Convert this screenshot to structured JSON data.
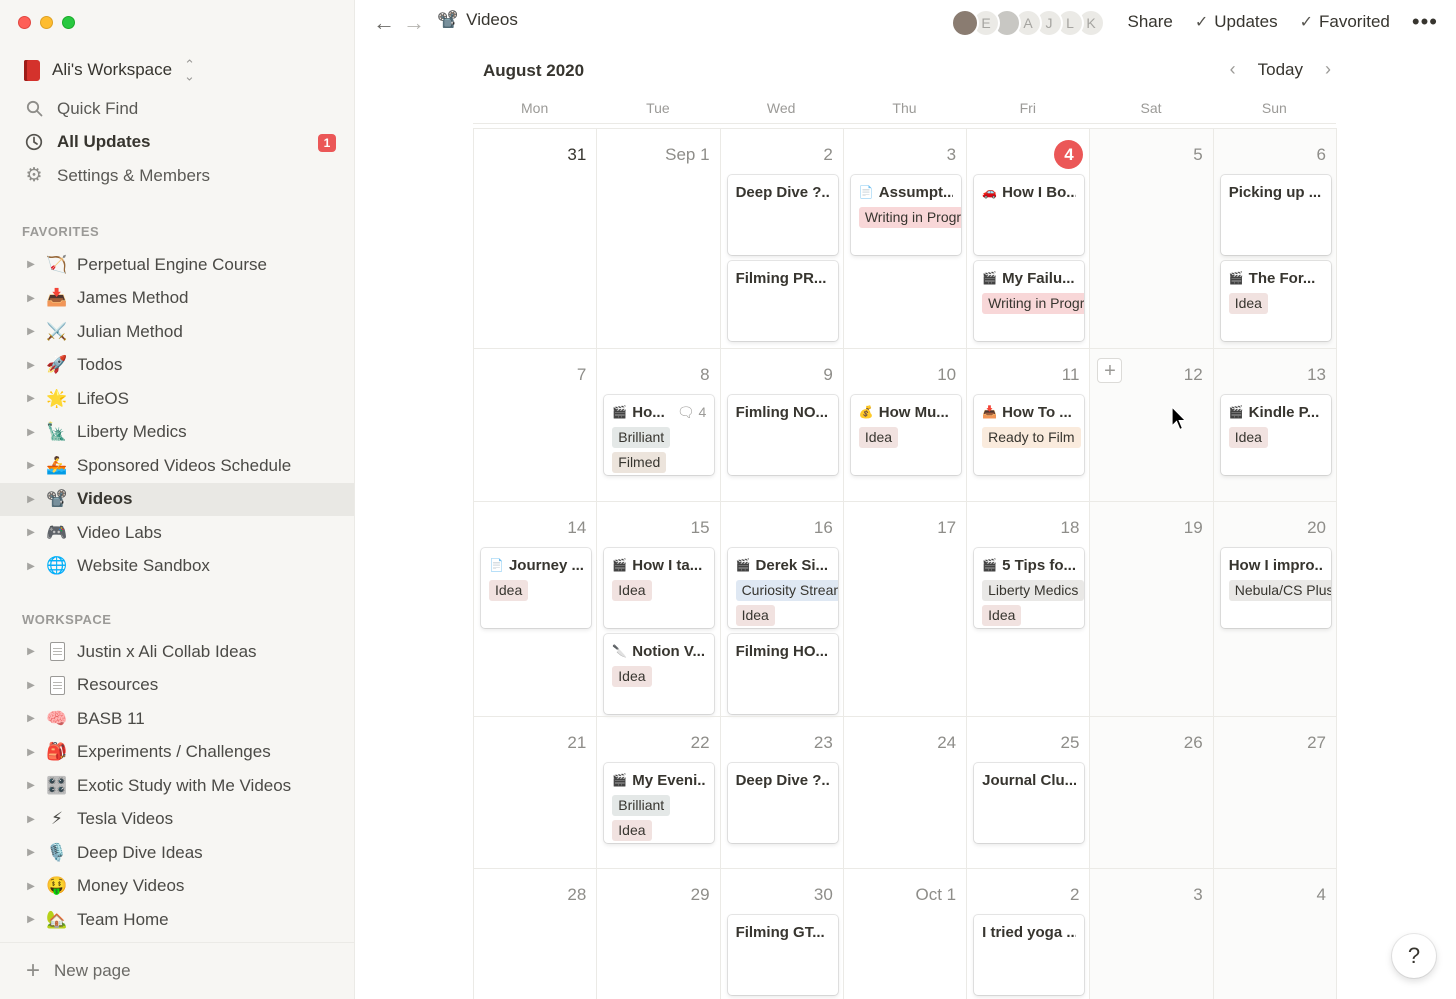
{
  "workspace": {
    "name": "Ali's Workspace"
  },
  "sidebar": {
    "top_items": [
      {
        "label": "Quick Find",
        "icon": "search-icon"
      },
      {
        "label": "All Updates",
        "icon": "clock-icon",
        "badge": "1"
      },
      {
        "label": "Settings & Members",
        "icon": "gear-icon"
      }
    ],
    "favorites_label": "FAVORITES",
    "favorites": [
      {
        "label": "Perpetual Engine Course",
        "emoji": "🏹"
      },
      {
        "label": "James Method",
        "emoji": "📥"
      },
      {
        "label": "Julian Method",
        "emoji": "⚔️"
      },
      {
        "label": "Todos",
        "emoji": "🚀"
      },
      {
        "label": "LifeOS",
        "emoji": "🌟"
      },
      {
        "label": "Liberty Medics",
        "emoji": "🗽"
      },
      {
        "label": "Sponsored Videos Schedule",
        "emoji": "🚣"
      },
      {
        "label": "Videos",
        "emoji": "📽️"
      },
      {
        "label": "Video Labs",
        "emoji": "🎮"
      },
      {
        "label": "Website Sandbox",
        "emoji": "🌐"
      }
    ],
    "workspace_label": "WORKSPACE",
    "workspace_pages": [
      {
        "label": "Justin x Ali Collab Ideas",
        "emoji": "doc"
      },
      {
        "label": "Resources",
        "emoji": "doc"
      },
      {
        "label": "BASB 11",
        "emoji": "🧠"
      },
      {
        "label": "Experiments / Challenges",
        "emoji": "🎒"
      },
      {
        "label": "Exotic Study with Me Videos",
        "emoji": "🎛️"
      },
      {
        "label": "Tesla Videos",
        "emoji": "⚡"
      },
      {
        "label": "Deep Dive Ideas",
        "emoji": "🎙️"
      },
      {
        "label": "Money Videos",
        "emoji": "🤑"
      },
      {
        "label": "Team Home",
        "emoji": "🏡"
      }
    ],
    "new_page": "New page"
  },
  "topbar": {
    "page_title": "Videos",
    "page_emoji": "📽️",
    "avatars": [
      "",
      "E",
      "",
      "A",
      "J",
      "L",
      "K"
    ],
    "share": "Share",
    "updates": "Updates",
    "favorited": "Favorited"
  },
  "calendar": {
    "month": "August 2020",
    "today": "Today",
    "weekdays": [
      "Mon",
      "Tue",
      "Wed",
      "Thu",
      "Fri",
      "Sat",
      "Sun"
    ],
    "weeks": [
      {
        "days": [
          {
            "num": "31",
            "dark": true,
            "cards": []
          },
          {
            "num": "Sep 1",
            "cards": []
          },
          {
            "num": "2",
            "cards": [
              {
                "title": "Deep Dive ?...",
                "icon": "",
                "tags": []
              },
              {
                "title": "Filming PR...",
                "icon": "",
                "tags": []
              }
            ]
          },
          {
            "num": "3",
            "cards": [
              {
                "title": "Assumpt...",
                "icon": "📄",
                "tags": [
                  {
                    "label": "Writing in Progress",
                    "kind": "writing"
                  }
                ]
              }
            ]
          },
          {
            "num": "4",
            "today": true,
            "cards": [
              {
                "title": "How I Bo...",
                "icon": "🚗",
                "tags": []
              },
              {
                "title": "My Failu...",
                "icon": "🎬",
                "tags": [
                  {
                    "label": "Writing in Progress",
                    "kind": "writing"
                  }
                ]
              }
            ]
          },
          {
            "num": "5",
            "weekend": true,
            "cards": []
          },
          {
            "num": "6",
            "weekend": true,
            "cards": [
              {
                "title": "Picking up ...",
                "icon": "",
                "tags": []
              },
              {
                "title": "The For...",
                "icon": "🎬",
                "tags": [
                  {
                    "label": "Idea",
                    "kind": "idea"
                  }
                ]
              }
            ]
          }
        ]
      },
      {
        "days": [
          {
            "num": "7",
            "cards": []
          },
          {
            "num": "8",
            "cards": [
              {
                "title": "Ho...",
                "icon": "🎬",
                "comments": "4",
                "tags": [
                  {
                    "label": "Brilliant",
                    "kind": "brilliant"
                  },
                  {
                    "label": "Filmed",
                    "kind": "filmed"
                  }
                ]
              }
            ]
          },
          {
            "num": "9",
            "cards": [
              {
                "title": "Fimling NO...",
                "icon": "",
                "tags": []
              }
            ]
          },
          {
            "num": "10",
            "cards": [
              {
                "title": "How Mu...",
                "icon": "💰",
                "tags": [
                  {
                    "label": "Idea",
                    "kind": "idea"
                  }
                ]
              }
            ]
          },
          {
            "num": "11",
            "cards": [
              {
                "title": "How To ...",
                "icon": "📥",
                "tags": [
                  {
                    "label": "Ready to Film",
                    "kind": "ready"
                  }
                ]
              }
            ]
          },
          {
            "num": "12",
            "weekend": true,
            "add": true,
            "cards": []
          },
          {
            "num": "13",
            "weekend": true,
            "cards": [
              {
                "title": "Kindle P...",
                "icon": "🎬",
                "tags": [
                  {
                    "label": "Idea",
                    "kind": "idea"
                  }
                ]
              }
            ]
          }
        ]
      },
      {
        "days": [
          {
            "num": "14",
            "cards": [
              {
                "title": "Journey ...",
                "icon": "📄",
                "tags": [
                  {
                    "label": "Idea",
                    "kind": "idea"
                  }
                ]
              }
            ]
          },
          {
            "num": "15",
            "cards": [
              {
                "title": "How I ta...",
                "icon": "🎬",
                "tags": [
                  {
                    "label": "Idea",
                    "kind": "idea"
                  }
                ]
              },
              {
                "title": "Notion V...",
                "icon": "🔪",
                "tags": [
                  {
                    "label": "Idea",
                    "kind": "idea"
                  }
                ]
              }
            ]
          },
          {
            "num": "16",
            "cards": [
              {
                "title": "Derek Si...",
                "icon": "🎬",
                "tags": [
                  {
                    "label": "Curiosity Stream",
                    "kind": "curiosity"
                  },
                  {
                    "label": "Idea",
                    "kind": "idea"
                  }
                ]
              },
              {
                "title": "Filming HO...",
                "icon": "",
                "tags": []
              }
            ]
          },
          {
            "num": "17",
            "cards": []
          },
          {
            "num": "18",
            "cards": [
              {
                "title": "5 Tips fo...",
                "icon": "🎬",
                "tags": [
                  {
                    "label": "Liberty Medics",
                    "kind": "liberty"
                  },
                  {
                    "label": "Idea",
                    "kind": "idea"
                  }
                ]
              }
            ]
          },
          {
            "num": "19",
            "weekend": true,
            "cards": []
          },
          {
            "num": "20",
            "weekend": true,
            "cards": [
              {
                "title": "How I impro...",
                "icon": "",
                "tags": [
                  {
                    "label": "Nebula/CS Plus",
                    "kind": "nebula"
                  }
                ]
              }
            ]
          }
        ]
      },
      {
        "days": [
          {
            "num": "21",
            "cards": []
          },
          {
            "num": "22",
            "cards": [
              {
                "title": "My Eveni...",
                "icon": "🎬",
                "tags": [
                  {
                    "label": "Brilliant",
                    "kind": "brilliant"
                  },
                  {
                    "label": "Idea",
                    "kind": "idea"
                  }
                ]
              }
            ]
          },
          {
            "num": "23",
            "cards": [
              {
                "title": "Deep Dive ?...",
                "icon": "",
                "tags": []
              }
            ]
          },
          {
            "num": "24",
            "cards": []
          },
          {
            "num": "25",
            "cards": [
              {
                "title": "Journal Clu...",
                "icon": "",
                "tags": []
              }
            ]
          },
          {
            "num": "26",
            "weekend": true,
            "cards": []
          },
          {
            "num": "27",
            "weekend": true,
            "cards": []
          }
        ]
      },
      {
        "days": [
          {
            "num": "28",
            "cards": []
          },
          {
            "num": "29",
            "cards": []
          },
          {
            "num": "30",
            "cards": [
              {
                "title": "Filming GT...",
                "icon": "",
                "tags": []
              }
            ]
          },
          {
            "num": "Oct 1",
            "cards": []
          },
          {
            "num": "2",
            "cards": [
              {
                "title": "I tried yoga ...",
                "icon": "",
                "tags": []
              }
            ]
          },
          {
            "num": "3",
            "weekend": true,
            "cards": []
          },
          {
            "num": "4",
            "weekend": true,
            "cards": []
          }
        ]
      }
    ]
  },
  "help": "?"
}
